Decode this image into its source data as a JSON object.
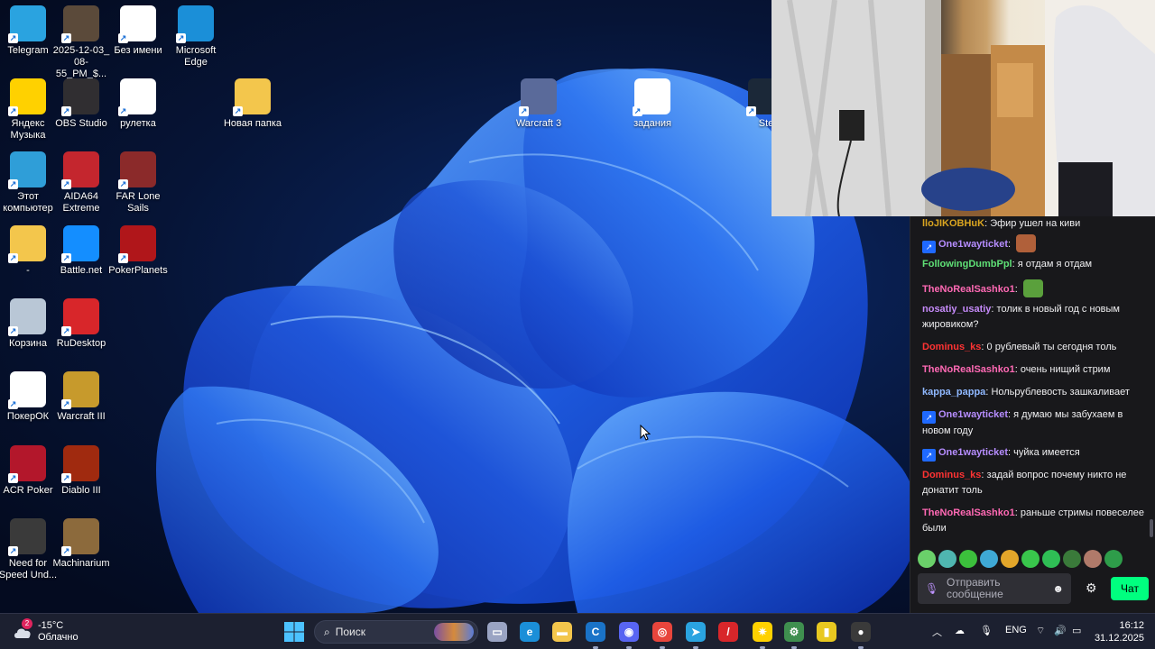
{
  "desktop": {
    "icons": [
      {
        "label": "Telegram",
        "icon": "telegram-icon",
        "color": "#2aa3e0"
      },
      {
        "label": "2025-12-03_ 08-55_PM_$...",
        "icon": "image-file-icon",
        "color": "#5b4a3a"
      },
      {
        "label": "Без имени",
        "icon": "paint-file-icon",
        "color": "#ffffff"
      },
      {
        "label": "Microsoft Edge",
        "icon": "edge-icon",
        "color": "#1b8fd8"
      },
      {
        "label": "Яндекс Музыка",
        "icon": "yandex-music-icon",
        "color": "#ffd100"
      },
      {
        "label": "OBS Studio",
        "icon": "obs-icon",
        "color": "#302e31"
      },
      {
        "label": "рулетка",
        "icon": "file-icon",
        "color": "#ffffff"
      },
      {
        "label": "Новая папка",
        "icon": "folder-icon",
        "color": "#f3c64c"
      },
      {
        "label": "Этот компьютер",
        "icon": "computer-icon",
        "color": "#2f9ed8"
      },
      {
        "label": "AIDA64 Extreme",
        "icon": "aida64-icon",
        "color": "#c4262e"
      },
      {
        "label": "FAR Lone Sails",
        "icon": "far-lone-sails-icon",
        "color": "#8b2a2a"
      },
      {
        "label": "-",
        "icon": "folder-icon",
        "color": "#f3c64c"
      },
      {
        "label": "Battle.net",
        "icon": "battlenet-icon",
        "color": "#148eff"
      },
      {
        "label": "PokerPlanets",
        "icon": "pokerplanets-icon",
        "color": "#b0161a"
      },
      {
        "label": "Корзина",
        "icon": "recycle-bin-icon",
        "color": "#b9c7d6"
      },
      {
        "label": "RuDesktop",
        "icon": "rudesktop-icon",
        "color": "#d8262a"
      },
      {
        "label": "ПокерОК",
        "icon": "pokerok-icon",
        "color": "#ffffff"
      },
      {
        "label": "Warcraft III",
        "icon": "warcraft3-icon",
        "color": "#c79a2c"
      },
      {
        "label": "ACR Poker",
        "icon": "acr-poker-icon",
        "color": "#b3172b"
      },
      {
        "label": "Diablo III",
        "icon": "diablo3-icon",
        "color": "#a02a0f"
      },
      {
        "label": "Need for Speed Und...",
        "icon": "nfs-icon",
        "color": "#3a3a3a"
      },
      {
        "label": "Machinarium",
        "icon": "machinarium-icon",
        "color": "#8c6a3c"
      },
      {
        "label": "Warcraft 3",
        "icon": "warcraft3-reforged-icon",
        "color": "#5a6a9a"
      },
      {
        "label": "задания",
        "icon": "text-file-icon",
        "color": "#ffffff"
      },
      {
        "label": "Ste",
        "icon": "steam-icon",
        "color": "#1b2838"
      }
    ]
  },
  "chat": {
    "messages": [
      {
        "user": "lloJIKOBHuK",
        "color": "#daa520",
        "text": "Эфир ушел на киви",
        "badge": false,
        "emote": false
      },
      {
        "user": "One1wayticket",
        "color": "#b68dff",
        "text": "",
        "badge": true,
        "emote": true,
        "emote_color": "#b0603a"
      },
      {
        "user": "FollowingDumbPpl",
        "color": "#5fe076",
        "text": "я отдам я отдам",
        "badge": false,
        "emote": false
      },
      {
        "user": "TheNoRealSashko1",
        "color": "#ff69b4",
        "text": "",
        "badge": false,
        "emote": true,
        "emote_color": "#5aa03c"
      },
      {
        "user": "nosatiy_usatiy",
        "color": "#c58af9",
        "text": "толик в новый год с новым жировиком?",
        "badge": false,
        "emote": false
      },
      {
        "user": "Dominus_ks",
        "color": "#ff3333",
        "text": "0 рублевый ты сегодня толь",
        "badge": false,
        "emote": false
      },
      {
        "user": "TheNoRealSashko1",
        "color": "#ff69b4",
        "text": "очень нищий стрим",
        "badge": false,
        "emote": false
      },
      {
        "user": "kappa_pappa",
        "color": "#8fb8ff",
        "text": "Нольрублевость зашкаливает",
        "badge": false,
        "emote": false
      },
      {
        "user": "One1wayticket",
        "color": "#b68dff",
        "text": "я думаю мы забухаем в новом году",
        "badge": true,
        "emote": false
      },
      {
        "user": "One1wayticket",
        "color": "#b68dff",
        "text": "чуйка имеется",
        "badge": true,
        "emote": false
      },
      {
        "user": "Dominus_ks",
        "color": "#ff3333",
        "text": "задай вопрос почему никто не донатит толь",
        "badge": false,
        "emote": false
      },
      {
        "user": "TheNoRealSashko1",
        "color": "#ff69b4",
        "text": "раньше стримы повеселее были",
        "badge": false,
        "emote": false
      }
    ],
    "input_placeholder": "Отправить сообщение",
    "send_label": "Чат",
    "accent": "#00ff7f"
  },
  "taskbar": {
    "weather_temp": "-15°C",
    "weather_desc": "Облачно",
    "weather_badge": "2",
    "search_label": "Поиск",
    "language": "ENG",
    "time": "16:12",
    "date": "31.12.2025",
    "pinned": [
      {
        "icon": "task-view-icon",
        "color": "#9aa4c3",
        "glyph": "▭"
      },
      {
        "icon": "edge-icon",
        "color": "#1b8fd8",
        "glyph": "e"
      },
      {
        "icon": "file-explorer-icon",
        "color": "#f3c64c",
        "glyph": "▬"
      },
      {
        "icon": "ccleaner-icon",
        "color": "#1a73c8",
        "glyph": "C"
      },
      {
        "icon": "discord-icon",
        "color": "#5865f2",
        "glyph": "◉"
      },
      {
        "icon": "chrome-icon",
        "color": "#e8453c",
        "glyph": "◎"
      },
      {
        "icon": "telegram-icon",
        "color": "#2aa3e0",
        "glyph": "➤"
      },
      {
        "icon": "rudesktop-icon",
        "color": "#d8262a",
        "glyph": "/"
      },
      {
        "icon": "yandex-music-icon",
        "color": "#ffd100",
        "glyph": "✷"
      },
      {
        "icon": "settings-app-icon",
        "color": "#3f8f4f",
        "glyph": "⚙"
      },
      {
        "icon": "yellow-app-icon",
        "color": "#e8c820",
        "glyph": "▮"
      },
      {
        "icon": "obs-recording-icon",
        "color": "#3a3a3a",
        "glyph": "●"
      }
    ]
  }
}
